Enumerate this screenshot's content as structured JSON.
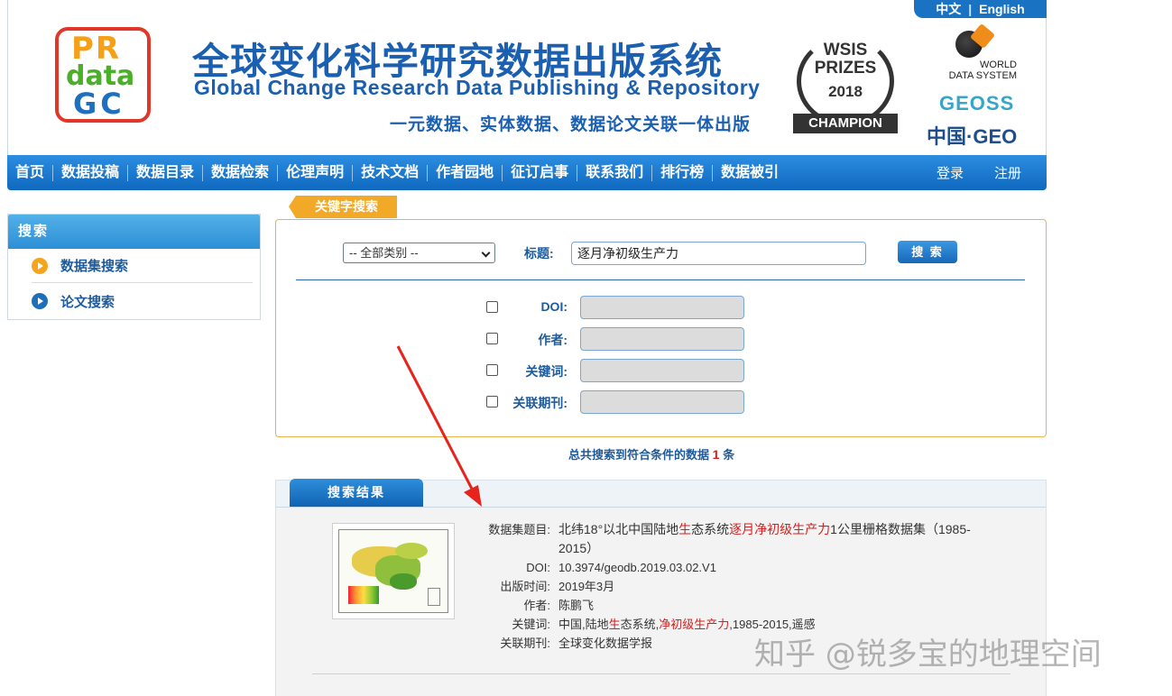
{
  "header": {
    "lang_cn": "中文",
    "lang_sep": "|",
    "lang_en": "English",
    "logo": {
      "l1": "PR",
      "l2": "data",
      "l3": "GC"
    },
    "title_cn": "全球变化科学研究数据出版系统",
    "title_en": "Global Change Research Data Publishing & Repository",
    "subtitle": "一元数据、实体数据、数据论文关联一体出版",
    "award": {
      "line1": "WSIS\nPRIZES",
      "line2": "2018",
      "line3": "CHAMPION"
    },
    "partners": {
      "wds": "WORLD\nDATA SYSTEM",
      "geoss": "GEOSS",
      "cngeo": "中国·GEO"
    }
  },
  "nav": {
    "items": [
      "首页",
      "数据投稿",
      "数据目录",
      "数据检索",
      "伦理声明",
      "技术文档",
      "作者园地",
      "征订启事",
      "联系我们",
      "排行榜",
      "数据被引"
    ],
    "login": "登录",
    "register": "注册"
  },
  "sidebar": {
    "title": "搜索",
    "items": [
      "数据集搜索",
      "论文搜索"
    ]
  },
  "search": {
    "tab_label": "关键字搜索",
    "category_value": "-- 全部类别 --",
    "title_label": "标题:",
    "title_value": "逐月净初级生产力",
    "button": "搜 索",
    "fields": [
      {
        "label": "DOI:",
        "value": ""
      },
      {
        "label": "作者:",
        "value": ""
      },
      {
        "label": "关键词:",
        "value": ""
      },
      {
        "label": "关联期刊:",
        "value": ""
      }
    ],
    "result_prefix": "总共搜索到符合条件的数据",
    "result_count": "1",
    "result_suffix": "条"
  },
  "results": {
    "tab_label": "搜索结果",
    "items": [
      {
        "title_label": "数据集题目:",
        "title_parts": [
          "北纬18°以北中国陆地",
          "生",
          "态系统",
          "逐月净初级生产力",
          "1公里栅格数据集（1985-2015）"
        ],
        "doi_label": "DOI:",
        "doi": "10.3974/geodb.2019.03.02.V1",
        "date_label": "出版时间:",
        "date": "2019年3月",
        "author_label": "作者:",
        "author": "陈鹏飞",
        "keywords_label": "关键词:",
        "keywords_parts": [
          "中国,陆地",
          "生",
          "态系统,",
          "净初级生产力",
          ",1985-2015,遥感"
        ],
        "journal_label": "关联期刊:",
        "journal": "全球变化数据学报"
      }
    ]
  },
  "watermark": "知乎 @锐多宝的地理空间",
  "colors": {
    "brand_blue": "#1b5fb0",
    "nav_blue": "#1a73c2",
    "accent_orange": "#f2a928",
    "highlight_red": "#d41f1f",
    "arrow_red": "#e8231c"
  }
}
